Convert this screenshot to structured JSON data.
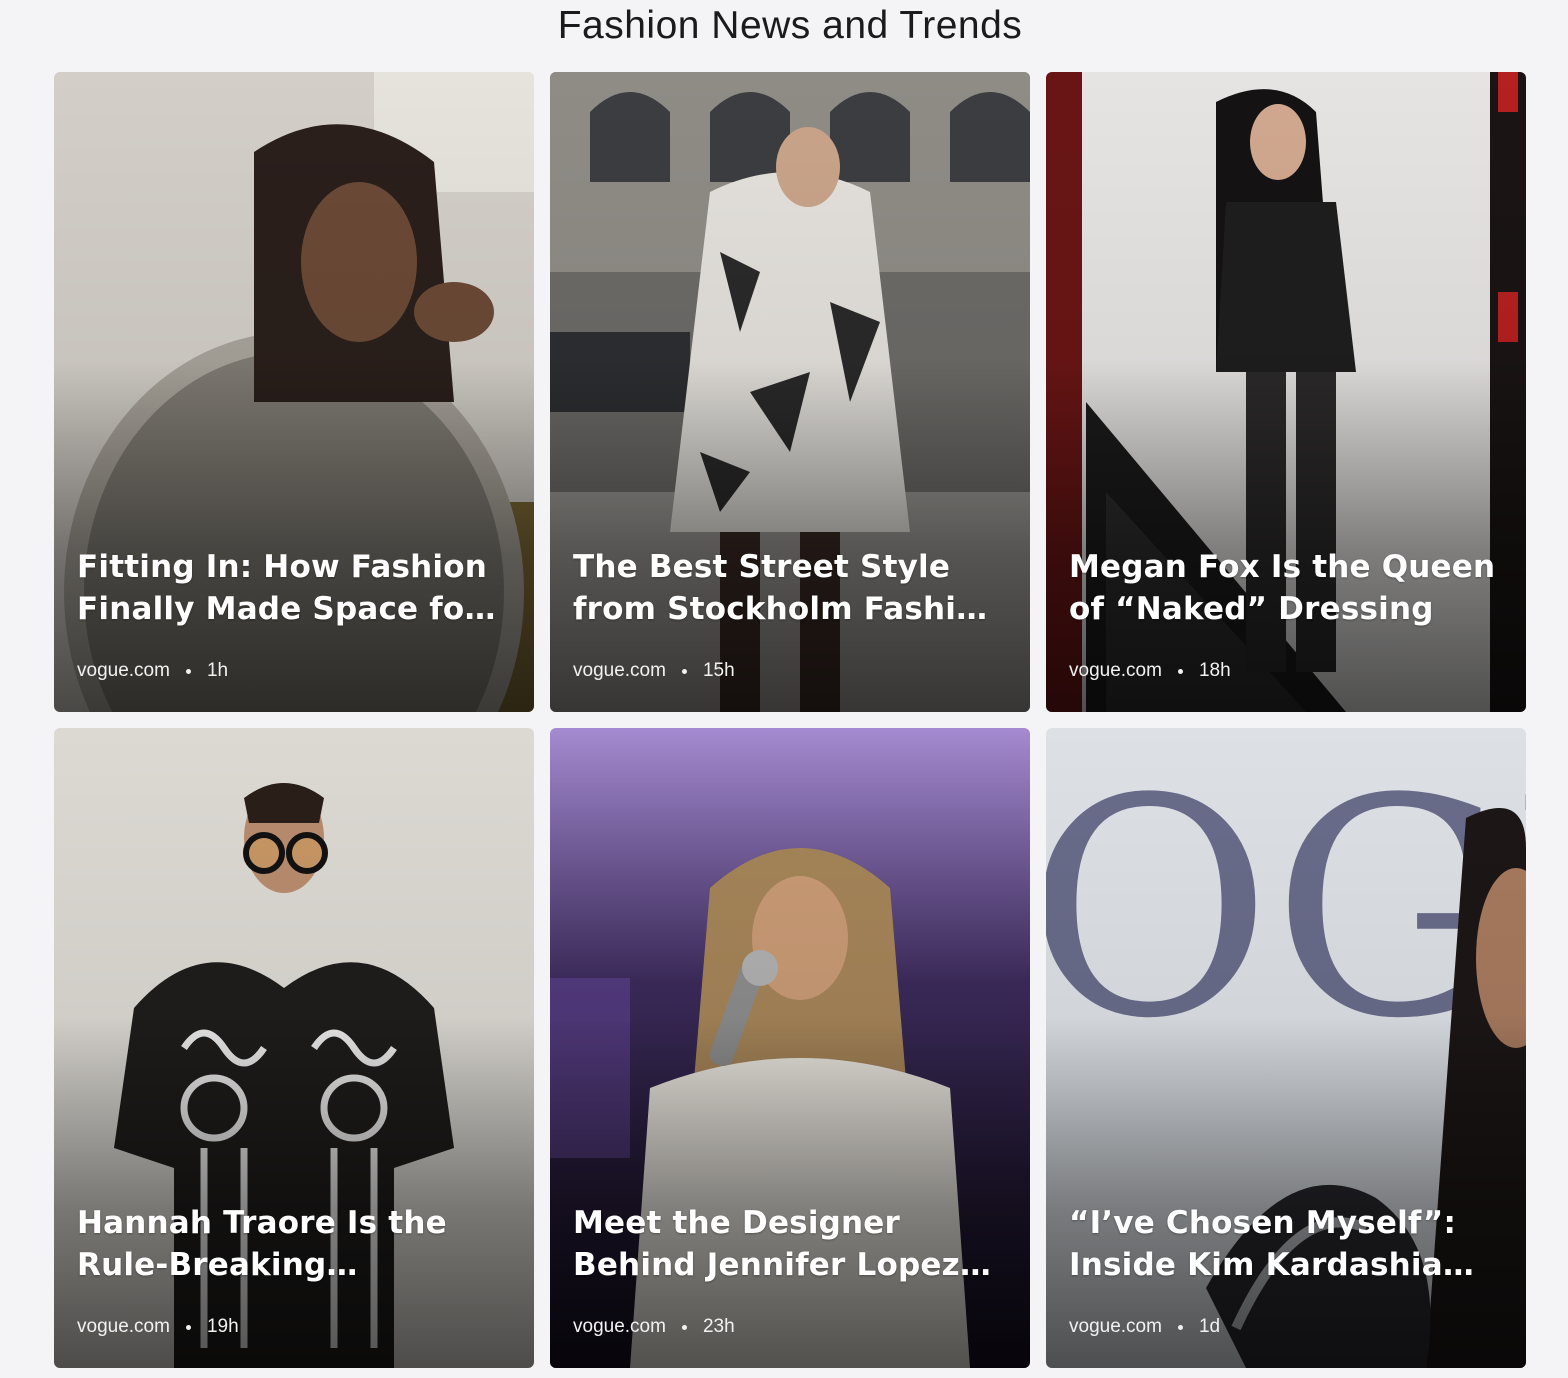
{
  "page": {
    "title": "Fashion News and Trends"
  },
  "articles": [
    {
      "title": "Fitting In: How Fashion Finally Made Space for Me",
      "source": "vogue.com",
      "time": "1h",
      "palette": {
        "bg": "#cfcac3",
        "accent": "#6f5f3a",
        "subject": "#3a2e27"
      }
    },
    {
      "title": "The Best Street Style from Stockholm Fashion Week…",
      "source": "vogue.com",
      "time": "15h",
      "palette": {
        "bg": "#6e6e6c",
        "accent": "#2f3134",
        "subject": "#d9d6d1"
      }
    },
    {
      "title": "Megan Fox Is the Queen of “Naked” Dressing",
      "source": "vogue.com",
      "time": "18h",
      "palette": {
        "bg": "#e9e7e6",
        "accent": "#7a1d1d",
        "subject": "#1a1a1a"
      }
    },
    {
      "title": "Hannah Traore Is the Rule-Breaking Downtown…",
      "source": "vogue.com",
      "time": "19h",
      "palette": {
        "bg": "#d8d5cf",
        "accent": "#2a2a2a",
        "subject": "#f0eee9"
      }
    },
    {
      "title": "Meet the Designer Behind Jennifer Lopez’s Latest Ja…",
      "source": "vogue.com",
      "time": "23h",
      "palette": {
        "bg": "#2a1d3e",
        "accent": "#8b68c0",
        "subject": "#ebe7e0"
      }
    },
    {
      "title": "“I’ve Chosen Myself”: Inside Kim Kardashian’s New…",
      "source": "vogue.com",
      "time": "1d",
      "palette": {
        "bg": "#d7dce2",
        "accent": "#4a4a68",
        "subject": "#1c1616"
      }
    }
  ]
}
